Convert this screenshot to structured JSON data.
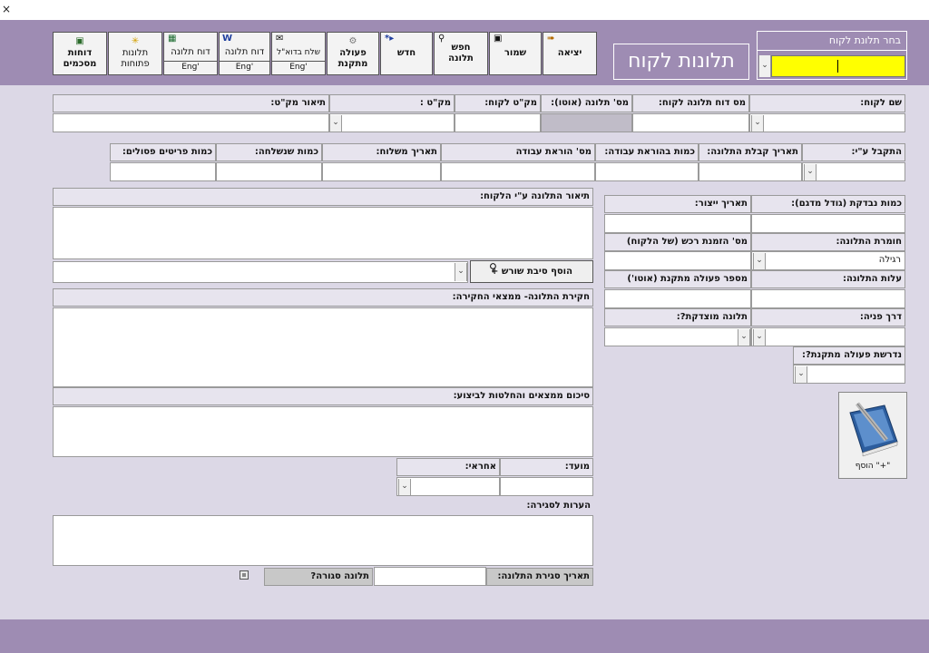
{
  "window": {
    "close_glyph": "×"
  },
  "toolbar": {
    "reports": "דוחות מסכמים",
    "open_complaints": "תלונות פתוחות",
    "complaint_report_1": "דוח תלונה",
    "complaint_report_1_sub": "Eng'",
    "complaint_report_2": "דוח תלונה",
    "complaint_report_2_sub": "Eng'",
    "send_email": "שלח בדוא\"ל",
    "send_email_sub": "Eng'",
    "corrective_action": "פעולה מתקנת",
    "new": "חדש",
    "search_complaint": "חפש תלונה",
    "save": "שמור",
    "exit": "יציאה"
  },
  "title": "תלונות לקוח",
  "picker": {
    "header": "בחר תלונת לקוח",
    "value": ""
  },
  "fields": {
    "customer_name": "שם לקוח:",
    "customer_complaint_report_no": "מס דוח תלונה לקוח:",
    "complaint_no_auto": "מס' תלונה (אוטו):",
    "customer_catalog_no": "מק\"ט לקוח:",
    "catalog_no": "מק\"ט :",
    "catalog_description": "תיאור מק\"ט:",
    "received_by": "התקבל ע\"י:",
    "complaint_receipt_date": "תאריך קבלת התלונה:",
    "work_order_qty": "כמות בהוראת עבודה:",
    "work_order_no": "מס' הוראת עבודה",
    "shipment_date": "תאריך משלוח:",
    "shipped_qty": "כמות שנשלחה:",
    "rejected_qty": "כמות פריטים פסולים:",
    "inspected_qty": "כמות נבדקת (גודל מדגם):",
    "production_date": "תאריך ייצור:",
    "complaint_severity": "חומרת התלונה:",
    "customer_po_no": "מס' הזמנת רכש (של הלקוח)",
    "severity_value": "רגילה",
    "complaint_cost": "עלות התלונה:",
    "corrective_action_no": "מספר פעולה מתקנת (אוטו')",
    "contact_method": "דרך פניה:",
    "justified_complaint": "תלונה מוצדקת?:",
    "requires_corrective_action": "נדרשת פעולה מתקנת?:",
    "customer_description": "תיאור התלונה ע\"י הלקוח:",
    "add_root_cause": "הוסף סיבת שורש +",
    "investigation": "חקירת התלונה- ממצאי החקירה:",
    "summary": "סיכום ממצאים והחלטות לביצוע:",
    "deadline": "מועד:",
    "responsible": "אחראי:",
    "closing_notes": "הערות לסגירה:",
    "closing_date": "תאריך סגירת התלונה:",
    "complaint_closed": "תלונה סגורה?",
    "add_button": "\"+\" הוסף"
  },
  "colors": {
    "header": "#9e8cb3",
    "form_bg": "#dcd8e6",
    "picker_input": "#ffff00"
  }
}
